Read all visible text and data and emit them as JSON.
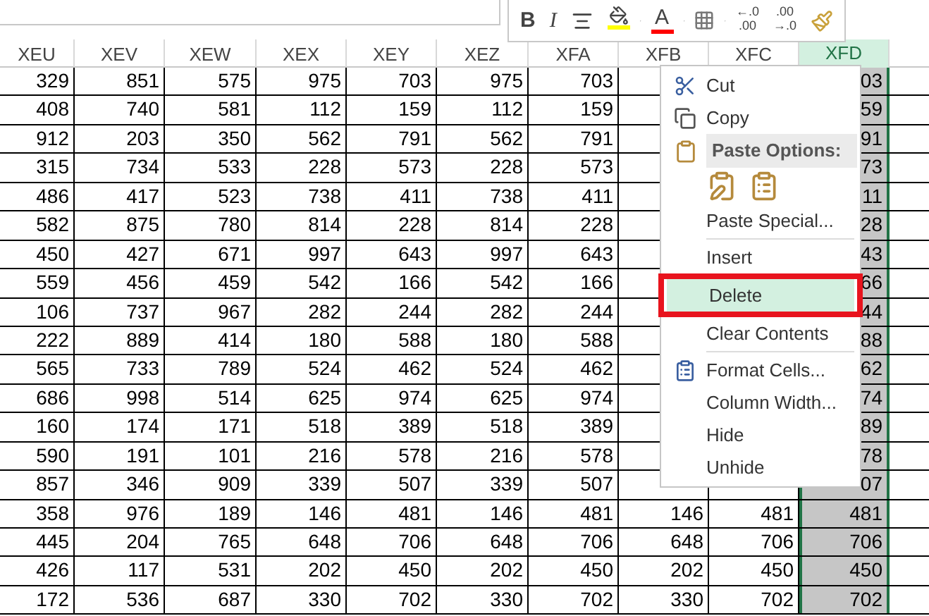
{
  "mini_toolbar": {
    "buttons": [
      {
        "kind": "bold",
        "label": "B"
      },
      {
        "kind": "italic",
        "label": "I"
      },
      {
        "kind": "align"
      },
      {
        "kind": "fill_color",
        "color": "#ffff00"
      },
      {
        "kind": "font_color",
        "label": "A",
        "color": "#ff0000"
      },
      {
        "kind": "borders"
      },
      {
        "kind": "decrease_decimal",
        "label": "←.0",
        "label_2": ".00"
      },
      {
        "kind": "increase_decimal",
        "label": ".00",
        "label_2": "→.0"
      },
      {
        "kind": "format_painter"
      }
    ]
  },
  "sheet": {
    "columns": [
      {
        "label": "XEU",
        "selected": false
      },
      {
        "label": "XEV",
        "selected": false
      },
      {
        "label": "XEW",
        "selected": false
      },
      {
        "label": "XEX",
        "selected": false
      },
      {
        "label": "XEY",
        "selected": false
      },
      {
        "label": "XEZ",
        "selected": false
      },
      {
        "label": "XFA",
        "selected": false
      },
      {
        "label": "XFB",
        "selected": false
      },
      {
        "label": "XFC",
        "selected": false
      },
      {
        "label": "XFD",
        "selected": true
      }
    ],
    "rows": [
      [
        "329",
        "851",
        "575",
        "975",
        "703",
        "975",
        "703",
        null,
        null,
        "03"
      ],
      [
        "408",
        "740",
        "581",
        "112",
        "159",
        "112",
        "159",
        null,
        null,
        "59"
      ],
      [
        "912",
        "203",
        "350",
        "562",
        "791",
        "562",
        "791",
        null,
        null,
        "91"
      ],
      [
        "315",
        "734",
        "533",
        "228",
        "573",
        "228",
        "573",
        null,
        null,
        "73"
      ],
      [
        "486",
        "417",
        "523",
        "738",
        "411",
        "738",
        "411",
        null,
        null,
        "11"
      ],
      [
        "582",
        "875",
        "780",
        "814",
        "228",
        "814",
        "228",
        null,
        null,
        "28"
      ],
      [
        "450",
        "427",
        "671",
        "997",
        "643",
        "997",
        "643",
        null,
        null,
        "43"
      ],
      [
        "559",
        "456",
        "459",
        "542",
        "166",
        "542",
        "166",
        null,
        null,
        "66"
      ],
      [
        "106",
        "737",
        "967",
        "282",
        "244",
        "282",
        "244",
        null,
        null,
        "44"
      ],
      [
        "222",
        "889",
        "414",
        "180",
        "588",
        "180",
        "588",
        null,
        null,
        "88"
      ],
      [
        "565",
        "733",
        "789",
        "524",
        "462",
        "524",
        "462",
        null,
        null,
        "62"
      ],
      [
        "686",
        "998",
        "514",
        "625",
        "974",
        "625",
        "974",
        null,
        null,
        "74"
      ],
      [
        "160",
        "174",
        "171",
        "518",
        "389",
        "518",
        "389",
        null,
        null,
        "89"
      ],
      [
        "590",
        "191",
        "101",
        "216",
        "578",
        "216",
        "578",
        null,
        null,
        "78"
      ],
      [
        "857",
        "346",
        "909",
        "339",
        "507",
        "339",
        "507",
        null,
        null,
        "07"
      ],
      [
        "358",
        "976",
        "189",
        "146",
        "481",
        "146",
        "481",
        "146",
        "481",
        "481"
      ],
      [
        "445",
        "204",
        "765",
        "648",
        "706",
        "648",
        "706",
        "648",
        "706",
        "706"
      ],
      [
        "426",
        "117",
        "531",
        "202",
        "450",
        "202",
        "450",
        "202",
        "450",
        "450"
      ],
      [
        "172",
        "536",
        "687",
        "330",
        "702",
        "330",
        "702",
        "330",
        "702",
        "702"
      ]
    ]
  },
  "context_menu": {
    "items": [
      {
        "kind": "item",
        "label": "Cut",
        "selected": false,
        "annotated": false
      },
      {
        "kind": "item",
        "label": "Copy",
        "selected": false,
        "annotated": false
      },
      {
        "kind": "header",
        "label": "Paste Options:"
      },
      {
        "kind": "paste_icons"
      },
      {
        "kind": "item",
        "label": "Paste Special...",
        "selected": false,
        "annotated": false
      },
      {
        "kind": "separator"
      },
      {
        "kind": "item",
        "label": "Insert",
        "selected": false,
        "annotated": false
      },
      {
        "kind": "item",
        "label": "Delete",
        "selected": true,
        "annotated": true
      },
      {
        "kind": "item",
        "label": "Clear Contents",
        "selected": false,
        "annotated": false
      },
      {
        "kind": "separator"
      },
      {
        "kind": "item",
        "label": "Format Cells...",
        "selected": false,
        "annotated": false
      },
      {
        "kind": "item",
        "label": "Column Width...",
        "selected": false,
        "annotated": false
      },
      {
        "kind": "item",
        "label": "Hide",
        "selected": false,
        "annotated": false
      },
      {
        "kind": "item",
        "label": "Unhide",
        "selected": false,
        "annotated": false
      }
    ]
  },
  "annotation": {
    "kind": "highlight_box",
    "color": "#e8141e"
  }
}
